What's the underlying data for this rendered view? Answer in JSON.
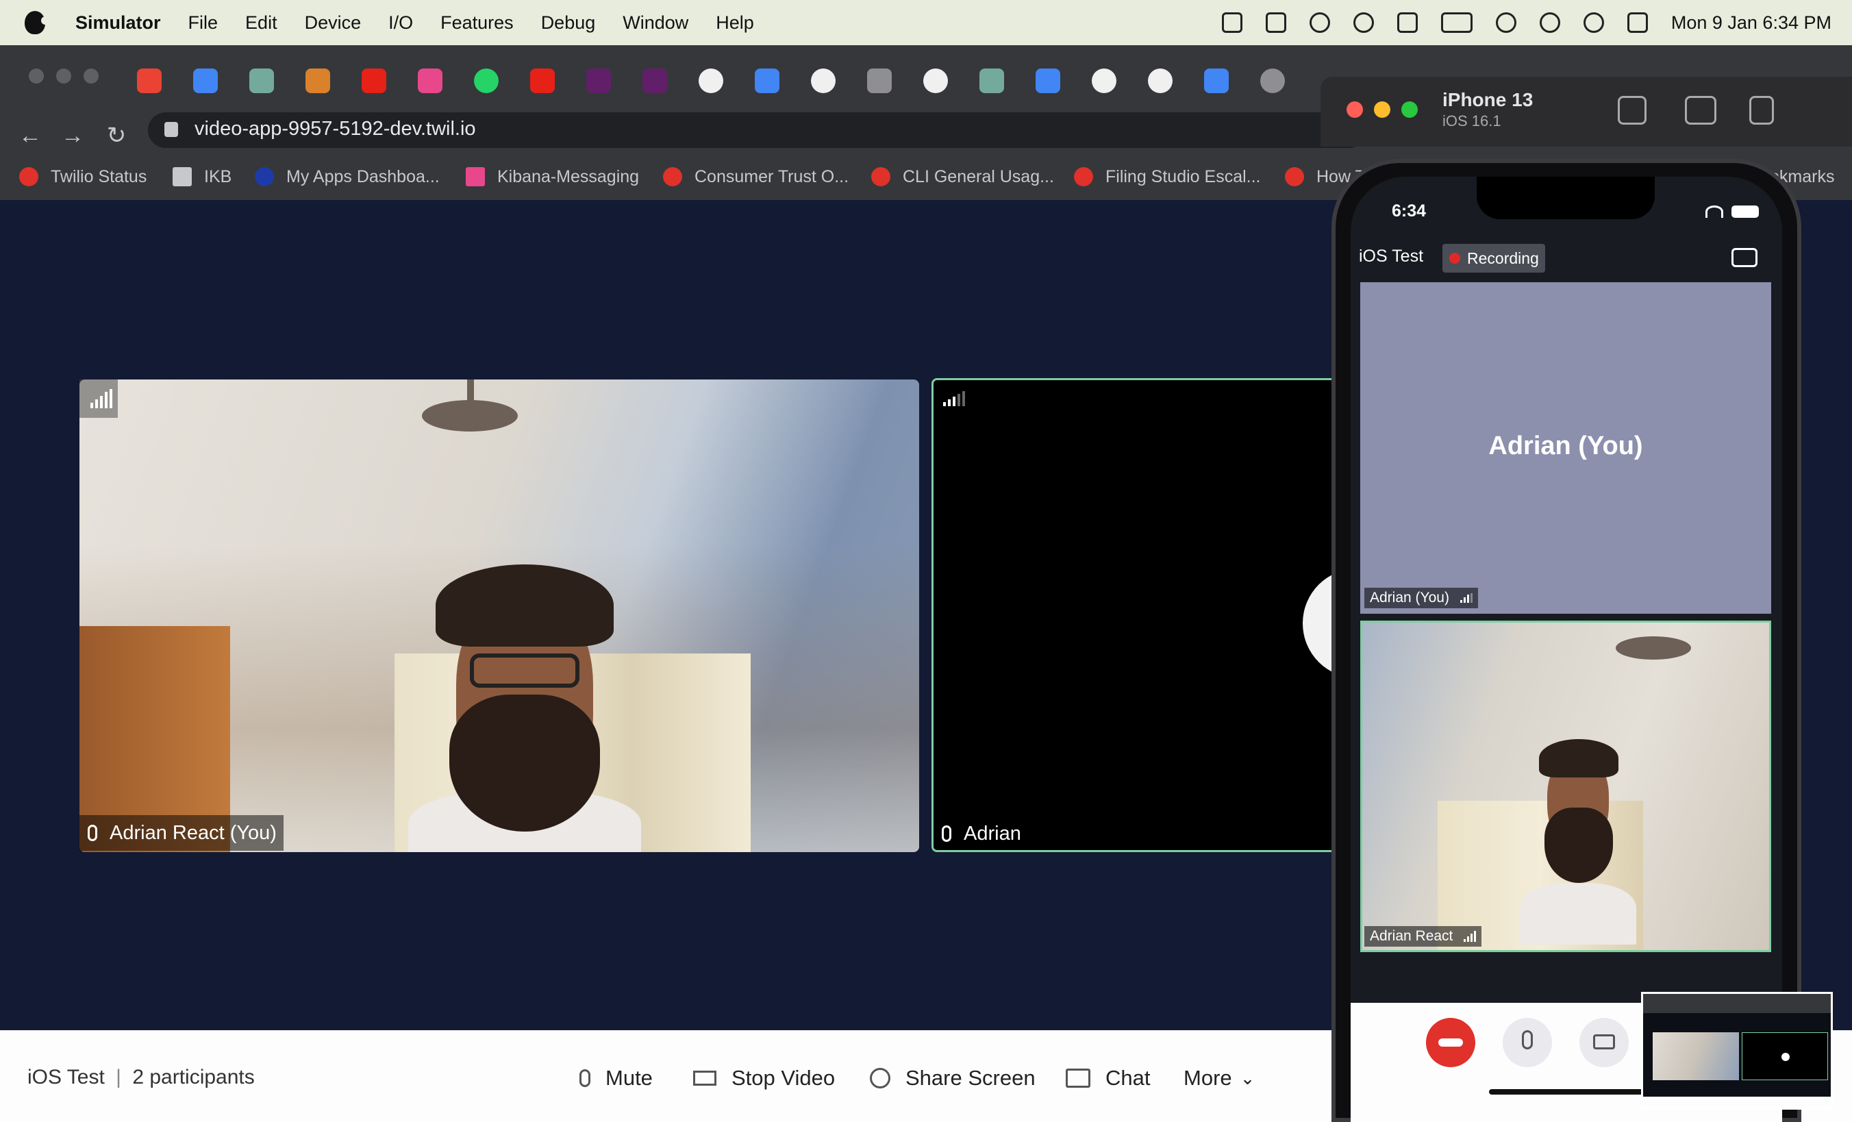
{
  "menubar": {
    "app": "Simulator",
    "items": [
      "File",
      "Edit",
      "Device",
      "I/O",
      "Features",
      "Debug",
      "Window",
      "Help"
    ],
    "clock": "Mon 9 Jan  6:34 PM"
  },
  "browser": {
    "url": "video-app-9957-5192-dev.twil.io",
    "bookmarks": [
      {
        "label": "Twilio Status",
        "color": "#e0312a"
      },
      {
        "label": "IKB",
        "color": "#c7c8cb"
      },
      {
        "label": "My Apps Dashboa...",
        "color": "#1d3aa8"
      },
      {
        "label": "Kibana-Messaging",
        "color": "#e8478b"
      },
      {
        "label": "Consumer Trust O...",
        "color": "#e0312a"
      },
      {
        "label": "CLI General Usag...",
        "color": "#e0312a"
      },
      {
        "label": "Filing Studio Escal...",
        "color": "#e0312a"
      },
      {
        "label": "How T",
        "color": "#e0312a"
      }
    ],
    "bookmarks_overflow": "okmarks"
  },
  "video": {
    "local_label": "Adrian React (You)",
    "remote_label": "Adrian"
  },
  "controls": {
    "room": "iOS Test",
    "participants": "2 participants",
    "mute": "Mute",
    "stop_video": "Stop Video",
    "share_screen": "Share Screen",
    "chat": "Chat",
    "more": "More"
  },
  "simulator": {
    "device": "iPhone 13",
    "os": "iOS 16.1"
  },
  "phone": {
    "time": "6:34",
    "room": "iOS Test",
    "recording": "Recording",
    "tile1_center": "Adrian (You)",
    "tile1_label": "Adrian (You)",
    "tile2_label": "Adrian React"
  },
  "colors": {
    "page_bg": "#131a33",
    "active_border": "#7dcea0",
    "end_call": "#e0312a",
    "phone_tile": "#8c90ad"
  }
}
